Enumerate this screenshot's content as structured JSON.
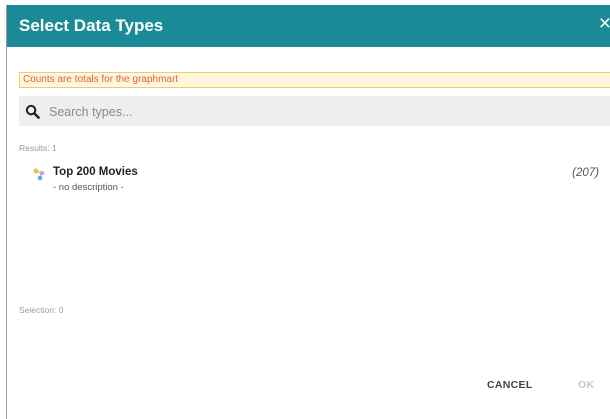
{
  "dialog": {
    "title": "Select Data Types",
    "close_symbol": "×"
  },
  "warning": {
    "text": "Counts are totals for the graphmart",
    "color": "#e0603a"
  },
  "search": {
    "placeholder": "Search types...",
    "value": "",
    "icon": "search-icon"
  },
  "results": {
    "label": "Results: 1",
    "items": [
      {
        "name": "Top 200 Movies",
        "description": "- no description -",
        "count": "(207)",
        "icon": "data-type-icon"
      }
    ]
  },
  "selection": {
    "label": "Selection: 0"
  },
  "footer": {
    "cancel_label": "CANCEL",
    "ok_label": "OK"
  },
  "colors": {
    "header": "#1a8b96",
    "warning_bg": "#fff8de",
    "warning_border": "#f0c970"
  }
}
